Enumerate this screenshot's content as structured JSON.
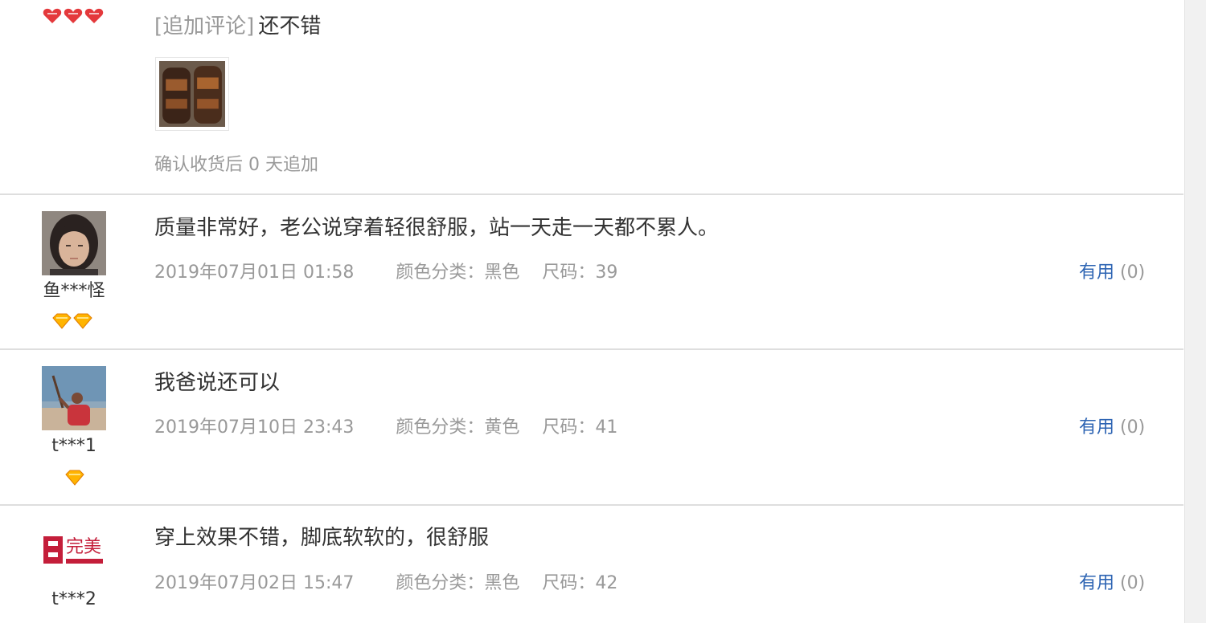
{
  "reviews": [
    {
      "append_tag": "[追加评论]",
      "text": "还不错",
      "after_note": "确认收货后 0 天追加",
      "user_level_icon": "red-heart-icon",
      "user_level_count": 3
    },
    {
      "username": "鱼***怪",
      "avatar_icon": "woman-portrait",
      "text": "质量非常好，老公说穿着轻很舒服，站一天走一天都不累人。",
      "date": "2019年07月01日 01:58",
      "color_label": "颜色分类：",
      "color_value": "黑色",
      "size_label": "尺码：",
      "size_value": "39",
      "useful_label": "有用",
      "useful_count": "(0)",
      "user_level_icon": "gold-diamond-icon",
      "user_level_count": 2
    },
    {
      "username": "t***1",
      "avatar_icon": "person-with-bat-beach",
      "text": "我爸说还可以",
      "date": "2019年07月10日 23:43",
      "color_label": "颜色分类：",
      "color_value": "黄色",
      "size_label": "尺码：",
      "size_value": "41",
      "useful_label": "有用",
      "useful_count": "(0)",
      "user_level_icon": "gold-diamond-icon",
      "user_level_count": 1
    },
    {
      "username": "t***2",
      "avatar_icon": "perfect-brand-logo",
      "avatar_logo_text": "完美",
      "text": "穿上效果不错，脚底软软的，很舒服",
      "date": "2019年07月02日 15:47",
      "color_label": "颜色分类：",
      "color_value": "黑色",
      "size_label": "尺码：",
      "size_value": "42",
      "useful_label": "有用",
      "useful_count": "(0)"
    }
  ],
  "colors": {
    "link": "#2d64b3",
    "muted": "#999999",
    "text": "#333333",
    "divider": "#dedede"
  }
}
